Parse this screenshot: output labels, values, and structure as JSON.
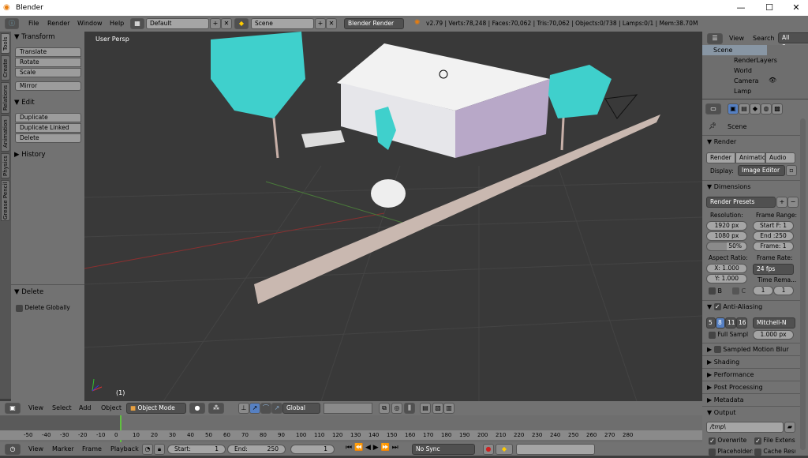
{
  "window": {
    "title": "Blender",
    "minimize": "—",
    "maximize": "☐",
    "close": "✕"
  },
  "info_header": {
    "menus": [
      "File",
      "Render",
      "Window",
      "Help"
    ],
    "screen_layout": "Default",
    "scene": "Scene",
    "engine": "Blender Render",
    "stats": "v2.79 | Verts:78,248 | Faces:70,062 | Tris:70,062 | Objects:0/738 | Lamps:0/1 | Mem:38.70M"
  },
  "tool_tabs": [
    "Tools",
    "Create",
    "Relations",
    "Animation",
    "Physics",
    "Grease Pencil"
  ],
  "tool_shelf": {
    "transform": {
      "title": "Transform",
      "buttons": [
        "Translate",
        "Rotate",
        "Scale",
        "Mirror"
      ]
    },
    "edit": {
      "title": "Edit",
      "buttons": [
        "Duplicate",
        "Duplicate Linked",
        "Delete"
      ]
    },
    "history": {
      "title": "History"
    },
    "operator": {
      "title": "Delete",
      "option": "Delete Globally"
    }
  },
  "viewport": {
    "view_label": "User Persp",
    "frame_label": "(1)",
    "bg": "#393939",
    "foliage_color": "#3fd0cc"
  },
  "view3d_header": {
    "menus": [
      "View",
      "Select",
      "Add",
      "Object"
    ],
    "mode": "Object Mode",
    "orientation": "Global"
  },
  "timeline": {
    "ticks": [
      -50,
      -40,
      -30,
      -20,
      -10,
      0,
      10,
      20,
      30,
      40,
      50,
      60,
      70,
      80,
      90,
      100,
      110,
      120,
      130,
      140,
      150,
      160,
      170,
      180,
      190,
      200,
      210,
      220,
      230,
      240,
      250,
      260,
      270,
      280
    ],
    "current_frame": 1,
    "header": {
      "menus": [
        "View",
        "Marker",
        "Frame",
        "Playback"
      ],
      "start_label": "Start:",
      "start": "1",
      "end_label": "End:",
      "end": "250",
      "frame": "1",
      "sync": "No Sync"
    }
  },
  "outliner": {
    "menus": [
      "View",
      "Search"
    ],
    "filter": "All Scenes",
    "items": [
      "Scene",
      "RenderLayers",
      "World",
      "Camera",
      "Lamp"
    ]
  },
  "properties": {
    "context": "Scene",
    "render": {
      "title": "Render",
      "render_btn": "Render",
      "anim_btn": "Animation",
      "audio_btn": "Audio",
      "display_label": "Display:",
      "display": "Image Editor"
    },
    "dimensions": {
      "title": "Dimensions",
      "presets": "Render Presets",
      "resolution_label": "Resolution:",
      "res_x": "1920 px",
      "res_y": "1080 px",
      "res_pct": "50%",
      "frame_range_label": "Frame Range:",
      "start": "Start F: 1",
      "end": "End :250",
      "frame": "Frame: 1",
      "aspect_label": "Aspect Ratio:",
      "aspect_x": "X:  1.000",
      "aspect_y": "Y:  1.000",
      "frame_rate_label": "Frame Rate:",
      "frame_rate": "24 fps",
      "time_remap_label": "Time Rema...",
      "remap_old": "1",
      "remap_new": "1",
      "border": "B",
      "crop": "C"
    },
    "anti_aliasing": {
      "title": "Anti-Aliasing",
      "samples": [
        "5",
        "8",
        "11",
        "16"
      ],
      "selected": "8",
      "filter": "Mitchell-N",
      "full_sample": "Full Sampl",
      "size": "1.000 px"
    },
    "collapsed": [
      "Sampled Motion Blur",
      "Shading",
      "Performance",
      "Post Processing",
      "Metadata"
    ],
    "output": {
      "title": "Output",
      "path": "/tmp\\",
      "overwrite": "Overwrite",
      "file_ext": "File Extensions",
      "placeholders": "Placeholders",
      "cache": "Cache Result"
    }
  },
  "colors": {
    "accent": "#5680c2",
    "header": "#727272",
    "current_frame": "#60c040"
  }
}
